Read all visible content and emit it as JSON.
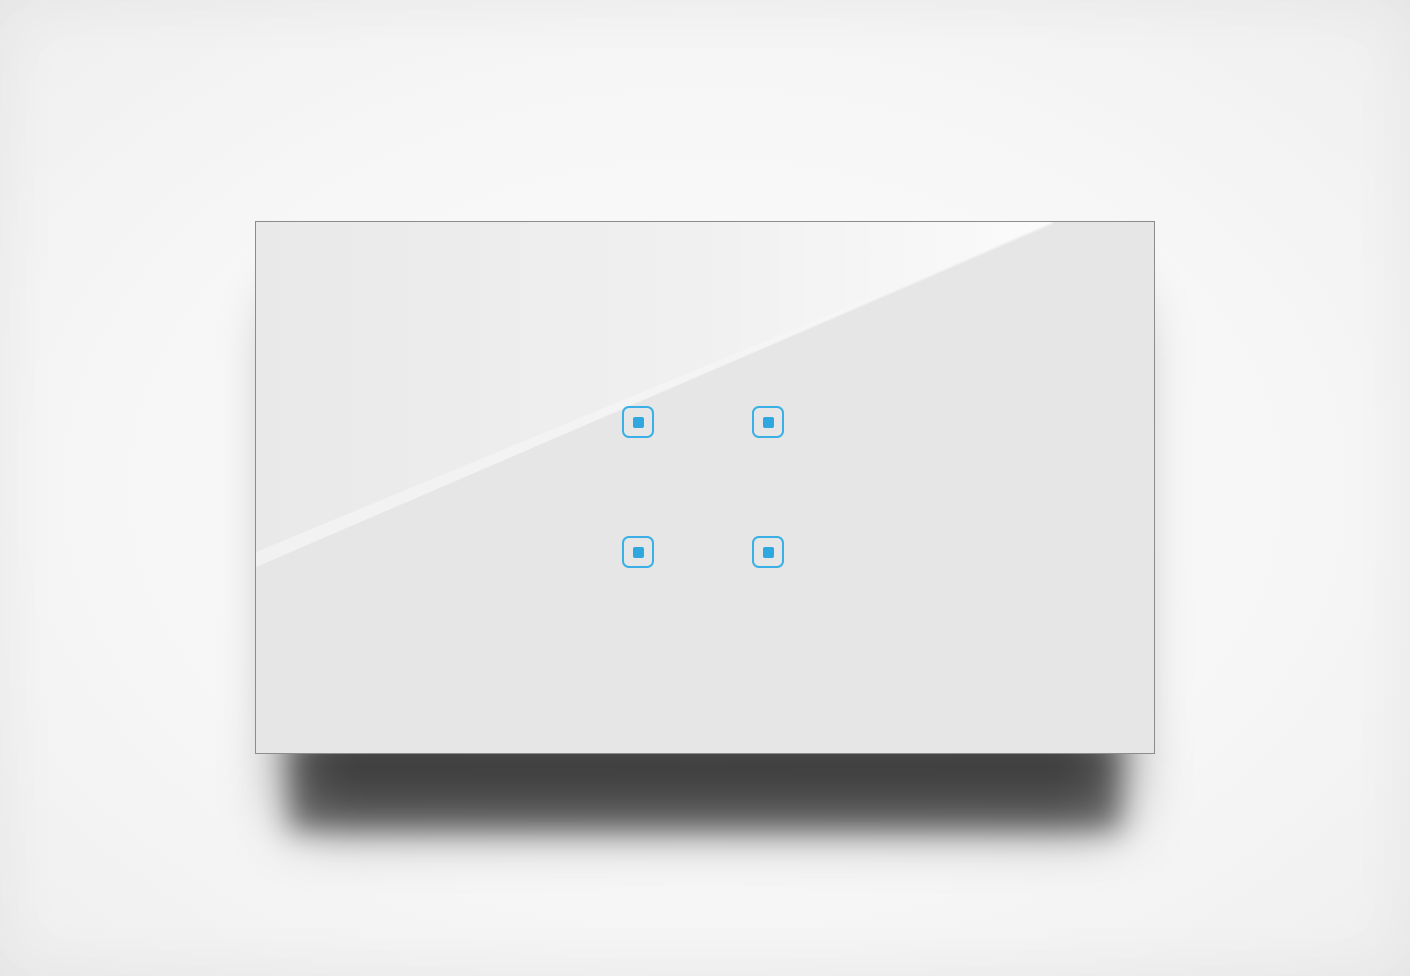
{
  "device": {
    "type": "glass-touch-switch",
    "panel_color": "#e6e6e6",
    "frame_color": "#8c8c8c",
    "accent_color": "#3ab0e6",
    "keys": [
      {
        "icon": "touch-key-icon",
        "state": "indicator-on"
      },
      {
        "icon": "touch-key-icon",
        "state": "indicator-on"
      },
      {
        "icon": "touch-key-icon",
        "state": "indicator-on"
      },
      {
        "icon": "touch-key-icon",
        "state": "indicator-on"
      }
    ]
  }
}
